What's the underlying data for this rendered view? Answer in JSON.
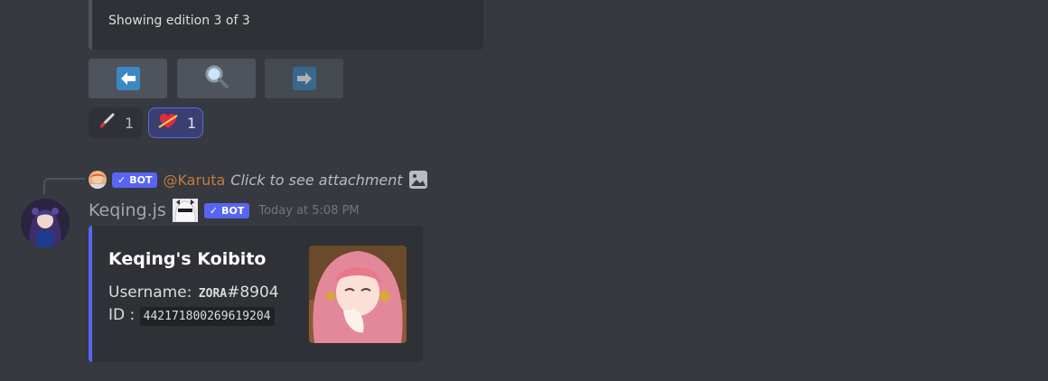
{
  "top_embed": {
    "footer": "Showing edition 3 of 3"
  },
  "buttons": [
    {
      "icon": "left-arrow-icon"
    },
    {
      "icon": "magnifier-icon"
    },
    {
      "icon": "right-arrow-icon"
    }
  ],
  "reactions": [
    {
      "emoji": "paintbrush-icon",
      "count": "1"
    },
    {
      "emoji": "heart-arrow-icon",
      "count": "1"
    }
  ],
  "reply": {
    "bot_label": "BOT",
    "mention": "@Karuta",
    "text": "Click to see attachment"
  },
  "message": {
    "author": "Keqing.js",
    "bot_label": "BOT",
    "timestamp": "Today at 5:08 PM"
  },
  "embed": {
    "title": "Keqing's Koibito",
    "username_label": "Username:",
    "username_name": "ZORA",
    "username_tag": "#8904",
    "id_label": "ID :",
    "id_value": "442171800269619204",
    "accent_color": "#5865f2"
  },
  "colors": {
    "background": "#36393f",
    "embed_background": "#2f3136",
    "button": "#4f545c",
    "mention": "#c27c3e"
  }
}
